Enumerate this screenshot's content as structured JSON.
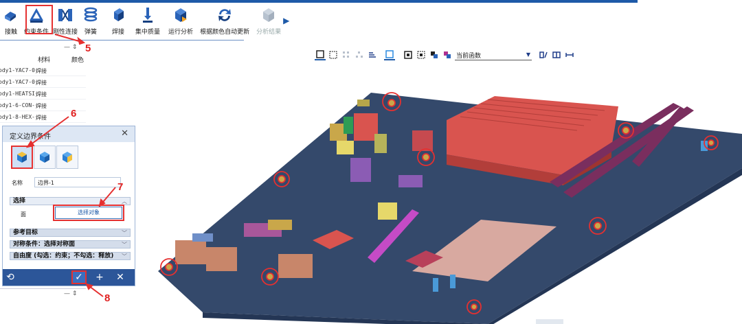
{
  "ribbon": {
    "items": [
      {
        "label": "接触",
        "icon": "contact-icon"
      },
      {
        "label": "约束条件",
        "icon": "constraint-icon"
      },
      {
        "label": "刚性连接",
        "icon": "rigid-connection-icon"
      },
      {
        "label": "弹簧",
        "icon": "spring-icon"
      },
      {
        "label": "焊接",
        "icon": "weld-icon"
      },
      {
        "label": "集中质量",
        "icon": "concentrated-mass-icon"
      },
      {
        "label": "运行分析",
        "icon": "run-analysis-icon"
      },
      {
        "label": "根据颜色自动更新",
        "icon": "auto-update-icon"
      },
      {
        "label": "分析结果",
        "icon": "analysis-results-icon"
      }
    ]
  },
  "panel": {
    "columns": [
      "材料",
      "颜色"
    ],
    "rows": [
      {
        "name": "ody1-YAC7-0.",
        "material": "焊接"
      },
      {
        "name": "ody1-YAC7-0.",
        "material": "焊接"
      },
      {
        "name": "ody1-HEATSI.",
        "material": "焊接"
      },
      {
        "name": "ody1-6-CON-.",
        "material": "焊接"
      },
      {
        "name": "ody1-8-HEX-.",
        "material": "焊接"
      }
    ],
    "toolbar_glyph": "—  ⇕"
  },
  "dialog": {
    "title": "定义边界条件",
    "name_label": "名称",
    "name_value": "边界-1",
    "select_section": "选择",
    "face_label": "面",
    "select_button": "选择对象",
    "sections": [
      "参考目标",
      "对称条件：选择对称面",
      "自由度 (勾选：约束；不勾选：释放)"
    ]
  },
  "view_toolbar": {
    "function_select": "当前函数"
  },
  "annotations": [
    "5",
    "6",
    "7",
    "8"
  ],
  "colors": {
    "accent": "#1e5aa8",
    "highlight": "#e53030",
    "board": "#34496b",
    "heatsink": "#d9544f"
  }
}
